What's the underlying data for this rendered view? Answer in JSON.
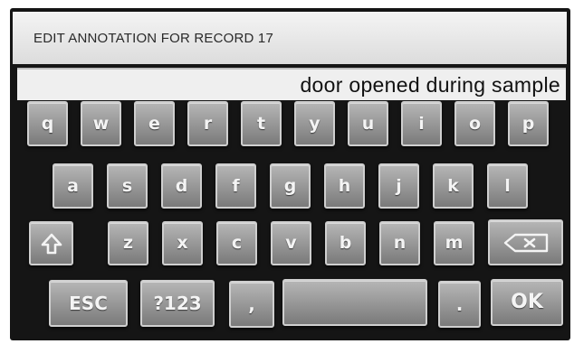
{
  "title": "EDIT ANNOTATION FOR RECORD 17",
  "text_value": "door opened during sample",
  "keyboard": {
    "row1": [
      "q",
      "w",
      "e",
      "r",
      "t",
      "y",
      "u",
      "i",
      "o",
      "p"
    ],
    "row2": [
      "a",
      "s",
      "d",
      "f",
      "g",
      "h",
      "j",
      "k",
      "l"
    ],
    "row3": [
      "z",
      "x",
      "c",
      "v",
      "b",
      "n",
      "m"
    ],
    "shift_icon": "shift-arrow-icon",
    "backspace_icon": "backspace-icon",
    "esc_label": "ESC",
    "symbols_label": "?123",
    "comma_label": ",",
    "period_label": ".",
    "ok_label": "OK"
  }
}
